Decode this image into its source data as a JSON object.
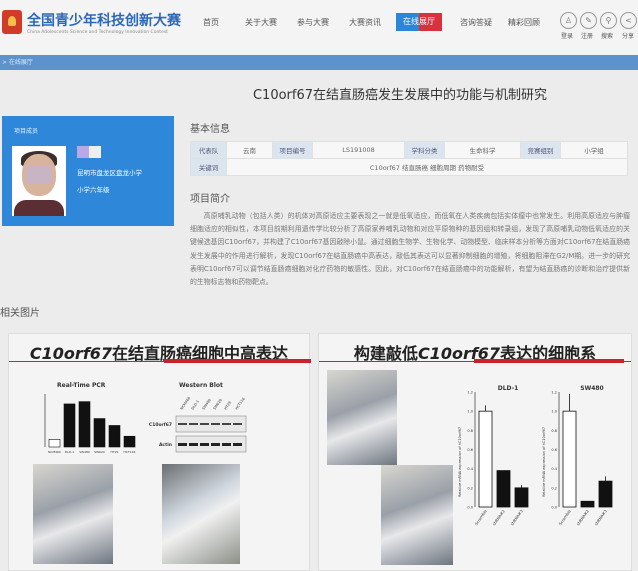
{
  "header": {
    "site_title": "全国青少年科技创新大赛",
    "site_subtitle": "China Adolescents Science and Technology Innovation Contest",
    "nav": [
      "首页",
      "关于大赛",
      "参与大赛",
      "大赛资讯",
      "在线展厅",
      "咨询答疑",
      "精彩回顾"
    ],
    "icons": [
      {
        "name": "user-icon",
        "glyph": "♙",
        "label": "登录"
      },
      {
        "name": "pencil-icon",
        "glyph": "✎",
        "label": "注册"
      },
      {
        "name": "search-icon",
        "glyph": "⚲",
        "label": "搜索"
      },
      {
        "name": "share-icon",
        "glyph": "<",
        "label": "分享"
      }
    ]
  },
  "breadcrumb": "> 在线展厅",
  "title": "C10orf67在结直肠癌发生发展中的功能与机制研究",
  "member": {
    "heading": "项目成员",
    "school": "昆明市盘龙区盘龙小学",
    "grade": "小学六年级"
  },
  "basic": {
    "heading": "基本信息",
    "row1": [
      "代表队",
      "云南",
      "项目编号",
      "LS191008",
      "学科分类",
      "生命科学",
      "竞赛组别",
      "小学组"
    ],
    "keyword_label": "关键词",
    "keywords": "C10orf67 结直肠癌 细胞周期 药物耐受"
  },
  "intro": {
    "heading": "项目简介",
    "text": "高原哺乳动物（包括人类）的机体对高原适应主要表现之一就是低氧适应，而低氧在人类疾病包括实体瘤中也常发生。利用高原适应与肿瘤细胞适应的相似性，本项目前期利用遗传学比较分析了高原家养哺乳动物和对应平原物种的基因组和转录组，发现了高原哺乳动物低氧适应的关键候选基因C10orf67，并构建了C10orf67基因敲除小鼠。通过细胞生物学、生物化学、动物模型、临床样本分析等方面对C10orf67在结直肠癌发生发展中的作用进行解析，发现C10orf67在结直肠癌中高表达，敲低其表达可以显著抑制细胞的增殖，将细胞阻滞在G2/M期。进一步的研究表明C10orf67可以调节结直肠癌细胞对化疗药物的敏感性。因此，对C10orf67在结直肠癌中的功能解析，有望为结直肠癌的诊断和治疗提供新的生物标志物和药物靶点。"
  },
  "related_heading": "相关图片",
  "panel1": {
    "title_gene": "C10orf67",
    "title_rest": "在结直肠癌细胞中高表达",
    "pcr_title": "Real-Time PCR",
    "wb_title": "Western Blot",
    "wb_rows": [
      "C10orf67",
      "Actin"
    ],
    "wb_lanes": [
      "NCM460",
      "DLD-1",
      "SW480",
      "SW620",
      "HT29",
      "HCT116"
    ],
    "pcr": {
      "categories": [
        "NCM460",
        "DLD-1",
        "SW480",
        "SW620",
        "HT29",
        "HCT116"
      ],
      "values": [
        1,
        5.6,
        5.9,
        3.7,
        2.8,
        1.4
      ]
    }
  },
  "panel2": {
    "title_pre": "构建敲低",
    "title_gene": "C10orf67",
    "title_rest": "表达的细胞系",
    "charts": [
      {
        "title": "DLD-1",
        "ylabel": "Relative mRNA expression of hC10orf67",
        "ylim": [
          0,
          1.2
        ],
        "yticks": [
          "0.0",
          "0.2",
          "0.4",
          "0.6",
          "0.8",
          "1.0",
          "1.2"
        ],
        "categories": [
          "Scramble",
          "shRNA#2",
          "shRNA#3"
        ],
        "values": [
          1.0,
          0.38,
          0.2
        ],
        "errors": [
          0.06,
          0,
          0.03
        ]
      },
      {
        "title": "SW480",
        "ylabel": "Relative mRNA expression of hC10orf67",
        "ylim": [
          0,
          1.2
        ],
        "yticks": [
          "0.0",
          "0.2",
          "0.4",
          "0.6",
          "0.8",
          "1.0",
          "1.2"
        ],
        "categories": [
          "Scramble",
          "shRNA#2",
          "shRNA#3"
        ],
        "values": [
          1.0,
          0.06,
          0.27
        ],
        "errors": [
          0.18,
          0,
          0.05
        ]
      }
    ]
  }
}
